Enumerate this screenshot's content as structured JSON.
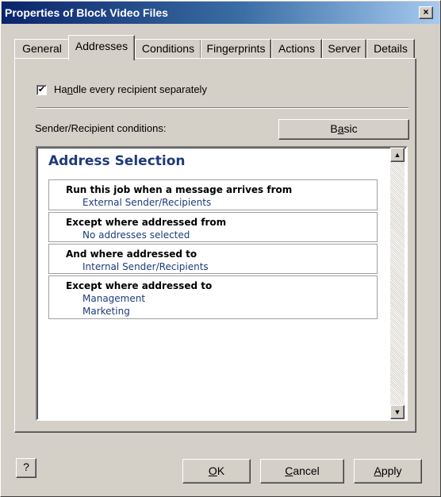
{
  "window": {
    "title": "Properties of Block Video Files",
    "close_glyph": "×",
    "close_icon": "close-icon"
  },
  "tabs": [
    {
      "label": "General",
      "active": false
    },
    {
      "label": "Addresses",
      "active": true
    },
    {
      "label": "Conditions",
      "active": false
    },
    {
      "label": "Fingerprints",
      "active": false
    },
    {
      "label": "Actions",
      "active": false
    },
    {
      "label": "Server",
      "active": false
    },
    {
      "label": "Details",
      "active": false
    }
  ],
  "checkbox": {
    "checked": true,
    "mark": "✔",
    "label_pre": "Ha",
    "label_accel": "n",
    "label_post": "dle every recipient separately"
  },
  "conditions_label": "Sender/Recipient conditions:",
  "basic_button": {
    "pre": "B",
    "accel": "a",
    "post": "sic"
  },
  "address_selection": {
    "title": "Address Selection",
    "conditions": [
      {
        "heading": "Run this job when a message arrives from",
        "values": [
          "External Sender/Recipients"
        ]
      },
      {
        "heading": "Except where addressed from",
        "values": [
          "No addresses selected"
        ]
      },
      {
        "heading": "And where addressed to",
        "values": [
          "Internal Sender/Recipients"
        ]
      },
      {
        "heading": "Except where addressed to",
        "values": [
          "Management",
          "Marketing"
        ]
      }
    ],
    "scroll_up_glyph": "▲",
    "scroll_down_glyph": "▼"
  },
  "buttons": {
    "help_glyph": "?",
    "help_icon": "help-icon",
    "ok": {
      "accel": "O",
      "post": "K"
    },
    "cancel": {
      "accel": "C",
      "post": "ancel"
    },
    "apply": {
      "accel": "A",
      "post": "pply"
    }
  },
  "colors": {
    "title_bar_start": "#0a246a",
    "link_blue": "#1f3a7a",
    "face": "#d4d0c8"
  }
}
